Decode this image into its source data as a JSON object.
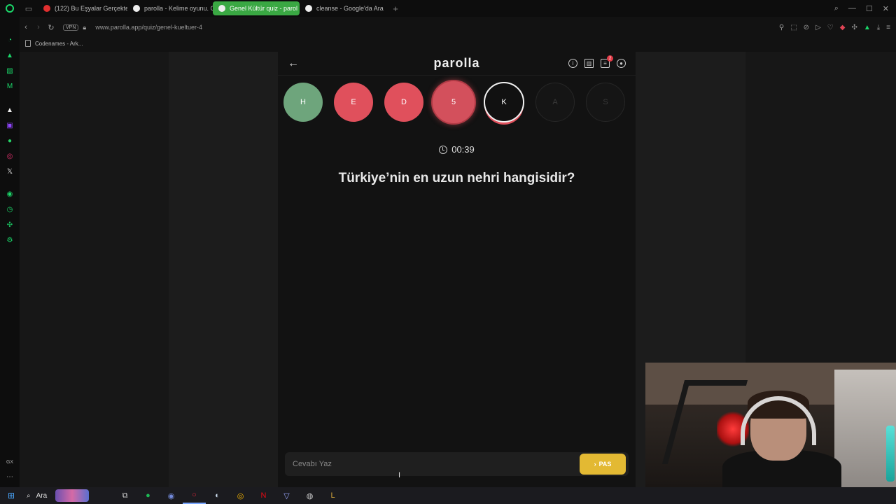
{
  "browser": {
    "tabs": [
      {
        "title": "(122) Bu Eşyalar Gerçekte",
        "color": "#e02f2f",
        "active": false
      },
      {
        "title": "parolla - Kelime oyunu. G",
        "color": "#eeeeee",
        "active": false
      },
      {
        "title": "Genel Kültür quiz - parol",
        "color": "#eeeeee",
        "active": true
      },
      {
        "title": "cleanse - Google'da Ara",
        "color": "#eeeeee",
        "active": false
      }
    ],
    "new_tab": "+",
    "vpn_label": "VPN",
    "url": "www.parolla.app/quiz/genel-kueltuer-4",
    "bookmark": "Codenames - Ark..."
  },
  "sidebar": {
    "bottom_label": "GX"
  },
  "app": {
    "brand": "parolla",
    "notification_count": "2",
    "letters": [
      {
        "letter": "H",
        "state": "correct"
      },
      {
        "letter": "E",
        "state": "wrong"
      },
      {
        "letter": "D",
        "state": "wrong"
      },
      {
        "letter": "5",
        "state": "wrong-highlight"
      },
      {
        "letter": "K",
        "state": "current"
      },
      {
        "letter": "A",
        "state": "pending"
      },
      {
        "letter": "S",
        "state": "pending"
      }
    ],
    "timer": "00:39",
    "question": "Türkiye’nin en uzun nehri hangisidir?",
    "answer_placeholder": "Cevabı Yaz",
    "pass_label": "PAS"
  },
  "taskbar": {
    "search_label": "Ara"
  },
  "colors": {
    "correct": "#6ea57c",
    "wrong": "#e0505c",
    "pass_button": "#e3b933",
    "brand_accent": "#1bd86a"
  }
}
